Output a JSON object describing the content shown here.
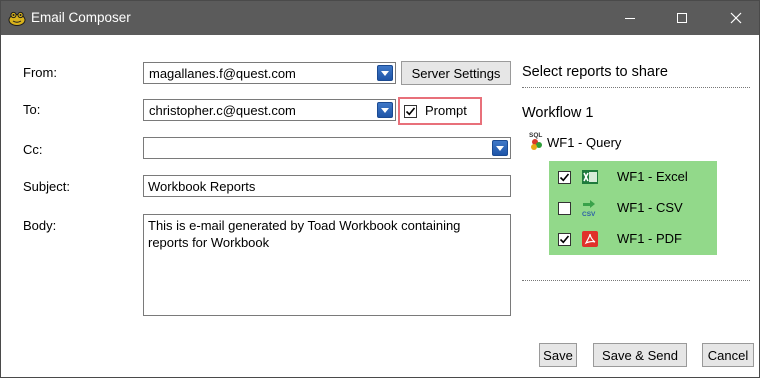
{
  "window": {
    "title": "Email Composer"
  },
  "form": {
    "from_label": "From:",
    "from_value": "magallanes.f@quest.com",
    "server_settings_label": "Server Settings",
    "to_label": "To:",
    "to_value": "christopher.c@quest.com",
    "prompt_label": "Prompt",
    "prompt_checked": true,
    "cc_label": "Cc:",
    "cc_value": "",
    "subject_label": "Subject:",
    "subject_value": "Workbook Reports",
    "body_label": "Body:",
    "body_value": "This is e-mail generated by Toad Workbook containing reports for Workbook"
  },
  "reports": {
    "heading": "Select reports to share",
    "workflow_title": "Workflow 1",
    "query_label": "WF1 - Query",
    "items": [
      {
        "label": "WF1 - Excel",
        "checked": true,
        "icon": "excel-icon"
      },
      {
        "label": "WF1 - CSV",
        "checked": false,
        "icon": "csv-icon"
      },
      {
        "label": "WF1 - PDF",
        "checked": true,
        "icon": "pdf-icon"
      }
    ]
  },
  "buttons": {
    "save": "Save",
    "save_send": "Save & Send",
    "cancel": "Cancel"
  },
  "colors": {
    "titlebar": "#5b5b5b",
    "report_panel": "#92d98a",
    "prompt_highlight": "#e8707a"
  }
}
